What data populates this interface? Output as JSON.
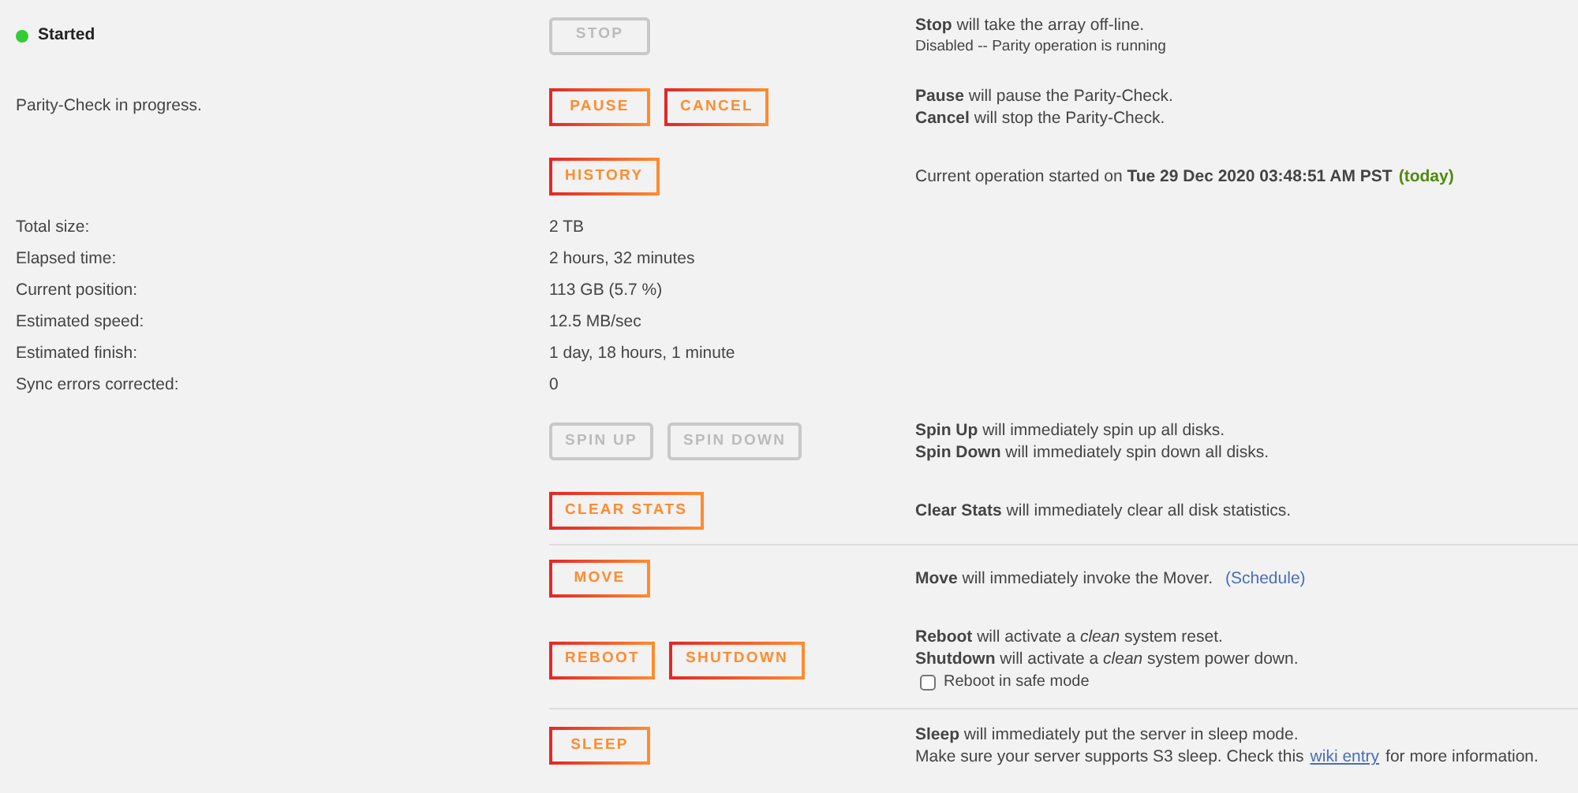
{
  "sections": [
    {
      "kind": "action",
      "divider_above": false,
      "status": {
        "label": "Started",
        "color": "#33cc33"
      },
      "buttons": [
        {
          "label": "STOP",
          "disabled": true
        }
      ],
      "lines": [
        {
          "text": "**Stop** will take the array off-line."
        }
      ],
      "note": "Disabled -- Parity operation is running"
    },
    {
      "kind": "action",
      "divider_above": false,
      "label": "Parity-Check in progress.",
      "buttons": [
        {
          "label": "PAUSE",
          "disabled": false
        },
        {
          "label": "CANCEL",
          "disabled": false
        }
      ],
      "lines": [
        {
          "text": "**Pause** will pause the Parity-Check."
        },
        {
          "text": "**Cancel** will stop the Parity-Check."
        }
      ]
    },
    {
      "kind": "action",
      "divider_above": false,
      "buttons": [
        {
          "label": "HISTORY",
          "disabled": false
        }
      ],
      "lines": [
        {
          "text": "Current operation started on **Tue 29 Dec 2020 03:48:51 AM PST**",
          "highlight": "(today)"
        }
      ]
    },
    {
      "kind": "stats",
      "items": [
        {
          "label": "Total size:",
          "value": "2 TB"
        },
        {
          "label": "Elapsed time:",
          "value": "2 hours, 32 minutes"
        },
        {
          "label": "Current position:",
          "value": "113 GB (5.7 %)"
        },
        {
          "label": "Estimated speed:",
          "value": "12.5 MB/sec"
        },
        {
          "label": "Estimated finish:",
          "value": "1 day, 18 hours, 1 minute"
        },
        {
          "label": "Sync errors corrected:",
          "value": "0"
        }
      ]
    },
    {
      "kind": "action",
      "divider_above": false,
      "buttons": [
        {
          "label": "SPIN UP",
          "disabled": true
        },
        {
          "label": "SPIN DOWN",
          "disabled": true
        }
      ],
      "lines": [
        {
          "text": "**Spin Up** will immediately spin up all disks."
        },
        {
          "text": "**Spin Down** will immediately spin down all disks."
        }
      ]
    },
    {
      "kind": "action",
      "divider_above": false,
      "buttons": [
        {
          "label": "CLEAR STATS",
          "disabled": false
        }
      ],
      "lines": [
        {
          "text": "**Clear Stats** will immediately clear all disk statistics."
        }
      ]
    },
    {
      "kind": "action",
      "divider_above": true,
      "buttons": [
        {
          "label": "MOVE",
          "disabled": false
        }
      ],
      "lines": [
        {
          "text": "**Move** will immediately invoke the Mover.",
          "link": "(Schedule)"
        }
      ]
    },
    {
      "kind": "action",
      "divider_above": false,
      "buttons": [
        {
          "label": "REBOOT",
          "disabled": false
        },
        {
          "label": "SHUTDOWN",
          "disabled": false
        }
      ],
      "lines": [
        {
          "text": "**Reboot** will activate a *clean* system reset."
        },
        {
          "text": "**Shutdown** will activate a *clean* system power down."
        }
      ],
      "checkbox": {
        "label": "Reboot in safe mode",
        "checked": false
      }
    },
    {
      "kind": "action",
      "divider_above": true,
      "buttons": [
        {
          "label": "SLEEP",
          "disabled": false
        }
      ],
      "lines": [
        {
          "text": "**Sleep** will immediately put the server in sleep mode."
        },
        {
          "text": "Make sure your server supports S3 sleep. Check this",
          "link": "wiki entry",
          "tail": "for more information."
        }
      ]
    }
  ]
}
